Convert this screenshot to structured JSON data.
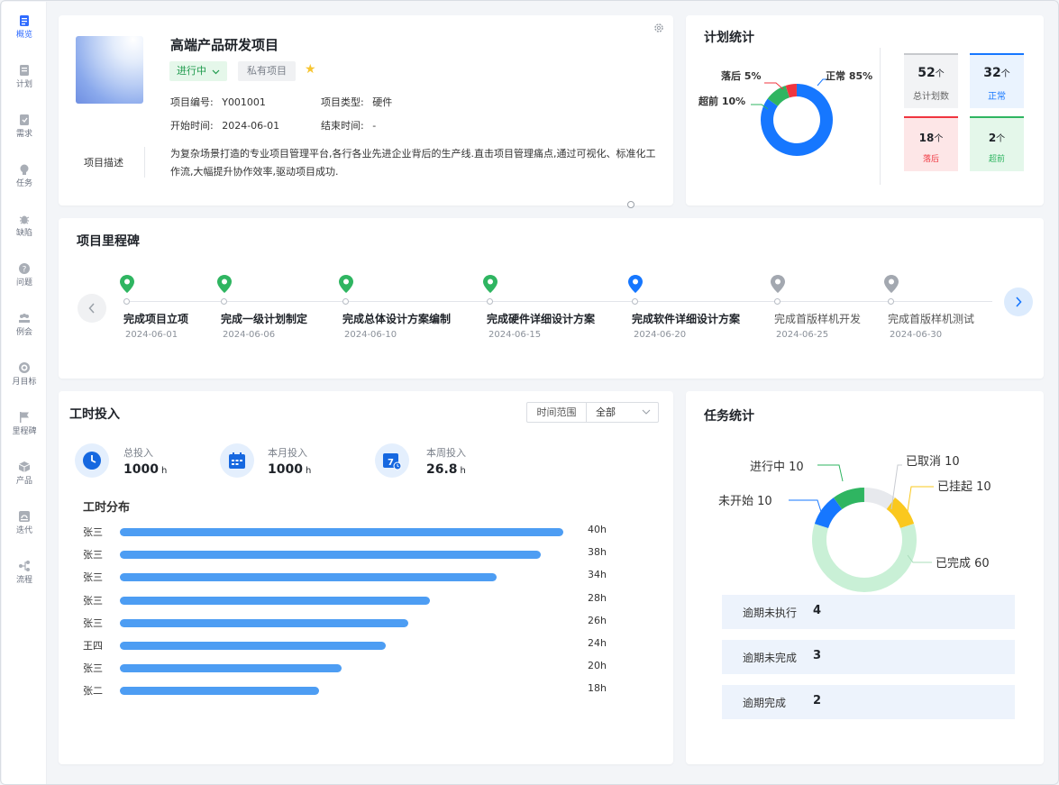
{
  "sidebar": {
    "items": [
      {
        "label": "概览",
        "icon": "overview-icon",
        "active": true
      },
      {
        "label": "计划",
        "icon": "plan-icon"
      },
      {
        "label": "需求",
        "icon": "requirement-icon"
      },
      {
        "label": "任务",
        "icon": "task-icon"
      },
      {
        "label": "缺陷",
        "icon": "bug-icon"
      },
      {
        "label": "问题",
        "icon": "question-icon"
      },
      {
        "label": "例会",
        "icon": "meeting-icon"
      },
      {
        "label": "月目标",
        "icon": "target-icon"
      },
      {
        "label": "里程碑",
        "icon": "flag-icon"
      },
      {
        "label": "产品",
        "icon": "product-icon"
      },
      {
        "label": "迭代",
        "icon": "iteration-icon"
      },
      {
        "label": "流程",
        "icon": "flow-icon"
      }
    ]
  },
  "project": {
    "name": "高端产品研发项目",
    "status": "进行中",
    "visibility": "私有项目",
    "code_label": "项目编号:",
    "code_value": "Y001001",
    "type_label": "项目类型:",
    "type_value": "硬件",
    "start_label": "开始时间:",
    "start_value": "2024-06-01",
    "end_label": "结束时间:",
    "end_value": "-",
    "desc_label": "项目描述",
    "desc_text": "为复杂场景打造的专业项目管理平台,各行各业先进企业背后的生产线.直击项目管理痛点,通过可视化、标准化工作流,大幅提升协作效率,驱动项目成功."
  },
  "plan_stats": {
    "title": "计划统计",
    "donut": [
      {
        "label": "正常 85%",
        "value": 85,
        "color": "#1677ff"
      },
      {
        "label": "超前 10%",
        "value": 10,
        "color": "#2fb561"
      },
      {
        "label": "落后 5%",
        "value": 5,
        "color": "#f0353f"
      }
    ],
    "boxes": [
      {
        "num": "52",
        "unit": "个",
        "caption": "总计划数"
      },
      {
        "num": "32",
        "unit": "个",
        "caption": "正常"
      },
      {
        "num": "18",
        "unit": "个",
        "caption": "落后"
      },
      {
        "num": "2",
        "unit": "个",
        "caption": "超前"
      }
    ],
    "colors": {
      "total": "#c7c9cd",
      "normal": "#1677ff",
      "late": "#f0353f",
      "ahead": "#2fb561"
    }
  },
  "milestones": {
    "title": "项目里程碑",
    "items": [
      {
        "title": "完成项目立项",
        "date": "2024-06-01",
        "state": "done"
      },
      {
        "title": "完成一级计划制定",
        "date": "2024-06-06",
        "state": "done"
      },
      {
        "title": "完成总体设计方案编制",
        "date": "2024-06-10",
        "state": "done"
      },
      {
        "title": "完成硬件详细设计方案",
        "date": "2024-06-15",
        "state": "done"
      },
      {
        "title": "完成软件详细设计方案",
        "date": "2024-06-20",
        "state": "current"
      },
      {
        "title": "完成首版样机开发",
        "date": "2024-06-25",
        "state": "pending"
      },
      {
        "title": "完成首版样机测试",
        "date": "2024-06-30",
        "state": "pending"
      }
    ]
  },
  "work_hours": {
    "title": "工时投入",
    "range_label": "时间范围",
    "range_value": "全部",
    "summary": [
      {
        "label": "总投入",
        "value": "1000",
        "unit": "h",
        "icon": "clock-icon"
      },
      {
        "label": "本月投入",
        "value": "1000",
        "unit": "h",
        "icon": "calendar-icon"
      },
      {
        "label": "本周投入",
        "value": "26.8",
        "unit": "h",
        "icon": "week-calendar-icon"
      }
    ],
    "dist_title": "工时分布",
    "bars": [
      {
        "name": "张三",
        "value": 40,
        "label": "40h"
      },
      {
        "name": "张三",
        "value": 38,
        "label": "38h"
      },
      {
        "name": "张三",
        "value": 34,
        "label": "34h"
      },
      {
        "name": "张三",
        "value": 28,
        "label": "28h"
      },
      {
        "name": "张三",
        "value": 26,
        "label": "26h"
      },
      {
        "name": "王四",
        "value": 24,
        "label": "24h"
      },
      {
        "name": "张三",
        "value": 20,
        "label": "20h"
      },
      {
        "name": "张二",
        "value": 18,
        "label": "18h"
      }
    ]
  },
  "task_stats": {
    "title": "任务统计",
    "donut": [
      {
        "label": "已取消 10",
        "value": 10,
        "color": "#e7e9ed"
      },
      {
        "label": "已挂起 10",
        "value": 10,
        "color": "#fac81e"
      },
      {
        "label": "已完成 60",
        "value": 60,
        "color": "#c9f0d6"
      },
      {
        "label": "未开始 10",
        "value": 10,
        "color": "#1677ff"
      },
      {
        "label": "进行中 10",
        "value": 10,
        "color": "#2fb561"
      }
    ],
    "overdue": [
      {
        "label": "逾期未执行",
        "value": "4"
      },
      {
        "label": "逾期未完成",
        "value": "3"
      },
      {
        "label": "逾期完成",
        "value": "2"
      }
    ]
  }
}
